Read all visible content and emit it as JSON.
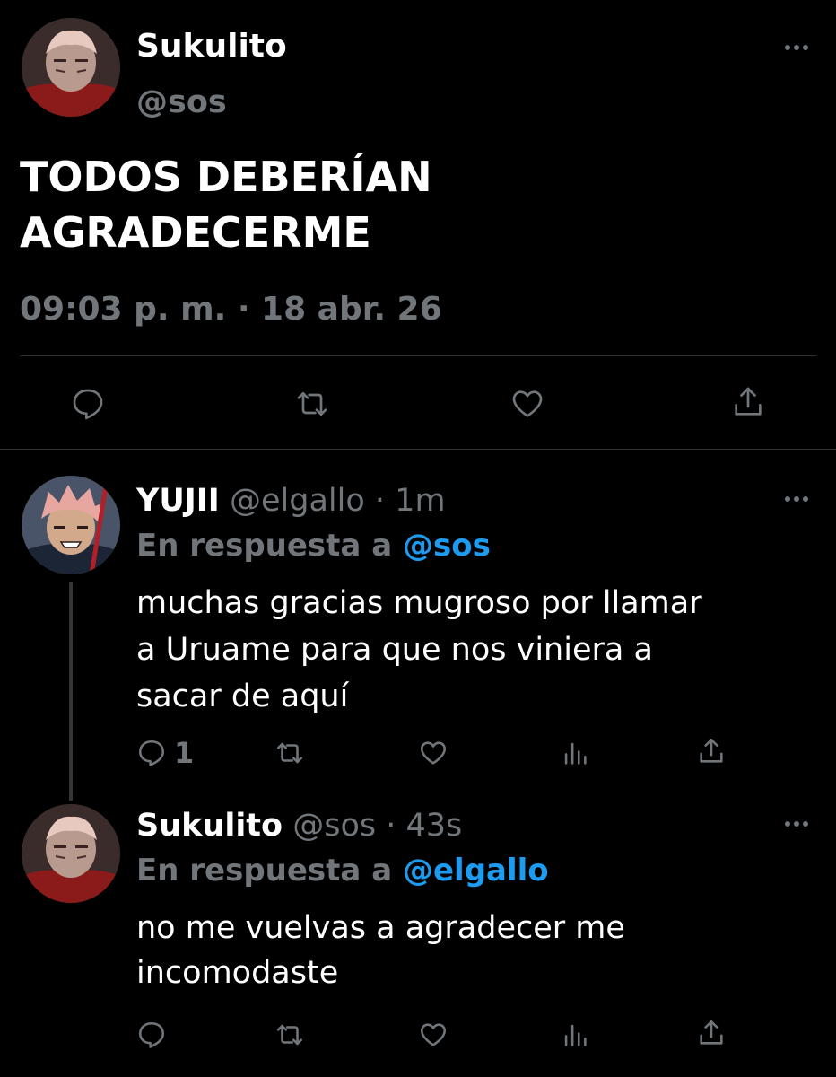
{
  "main_tweet": {
    "display_name": "Sukulito",
    "handle": "@sos",
    "text_line1": "TODOS DEBERÍAN",
    "text_line2": "AGRADECERME",
    "timestamp": "09:03 p. m. · 18 abr. 26",
    "actions": [
      "reply-icon",
      "retweet-icon",
      "like-icon",
      "share-icon"
    ]
  },
  "replies": [
    {
      "display_name": "YUJII",
      "handle": "@elgallo",
      "time": "· 1m",
      "reply_prefix": "En respuesta a",
      "reply_to": "@sos",
      "text_line1": "muchas gracias mugroso por llamar",
      "text_line2": "a Uruame para que nos viniera a",
      "text_line3": "sacar de aquí",
      "reply_count": "1"
    },
    {
      "display_name": "Sukulito",
      "handle": "@sos",
      "time": "· 43s",
      "reply_prefix": "En respuesta a",
      "reply_to": "@elgallo",
      "text_line1": "no me vuelvas a agradecer me",
      "text_line2": "incomodaste",
      "reply_count": ""
    }
  ],
  "colors": {
    "background": "#000000",
    "text": "#ffffff",
    "muted": "#71767b",
    "link": "#1d9bf0",
    "divider": "#2f3336"
  }
}
